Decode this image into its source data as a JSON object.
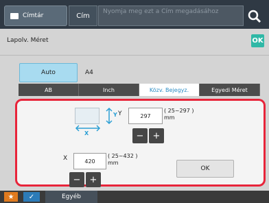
{
  "topbar": {
    "directory_label": "Címtár",
    "cim_label": "Cím",
    "input_placeholder": "Nyomja meg ezt a Cím megadásához",
    "search_icon": "search-icon"
  },
  "dialog": {
    "title": "Lapolv. Méret",
    "ok_top": "OK",
    "auto_label": "Auto",
    "detected_size": "A4",
    "tabs": [
      {
        "label": "AB",
        "active": false
      },
      {
        "label": "Inch",
        "active": false
      },
      {
        "label": "Közv. Bejegyz.",
        "active": true
      },
      {
        "label": "Egyedi Méret",
        "active": false
      }
    ],
    "diagram": {
      "x_axis_label": "X",
      "y_axis_label": "Y"
    },
    "y_field": {
      "label": "Y",
      "value": "297",
      "range": "( 25~297 )",
      "unit": "mm"
    },
    "x_field": {
      "label": "X",
      "value": "420",
      "range": "( 25~432 )",
      "unit": "mm"
    },
    "stepper": {
      "minus": "−",
      "plus": "+"
    },
    "ok_button": "OK",
    "highlight_color": "#e8243a",
    "accent_color": "#2fb8a6"
  },
  "bottombar": {
    "star_icon": "star-icon",
    "check_icon": "check-icon",
    "other_label": "Egyéb"
  }
}
